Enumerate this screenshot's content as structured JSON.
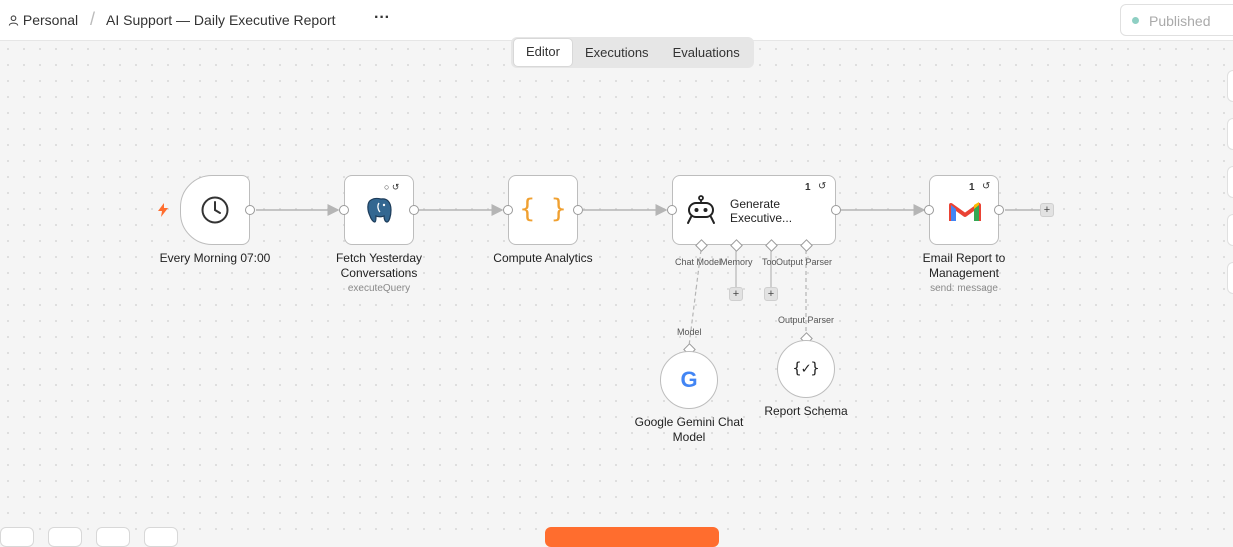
{
  "header": {
    "project": "Personal",
    "separator": "/",
    "workflow_name": "AI Support — Daily Executive Report",
    "more": "···",
    "status": "Published"
  },
  "tabs": [
    "Editor",
    "Executions",
    "Evaluations"
  ],
  "nodes": {
    "schedule": {
      "label": "Every Morning 07:00"
    },
    "postgres": {
      "label1": "Fetch Yesterday",
      "label2": "Conversations",
      "sub": "executeQuery"
    },
    "code": {
      "label": "Compute Analytics",
      "glyph": "{ }"
    },
    "agent": {
      "title1": "Generate",
      "title2": "Executive...",
      "badge": "1"
    },
    "gmail": {
      "label1": "Email Report to",
      "label2": "Management",
      "sub": "send: message",
      "badge": "1"
    },
    "gemini": {
      "label1": "Google Gemini Chat",
      "label2": "Model",
      "glyph": "G"
    },
    "schema": {
      "label": "Report Schema",
      "glyph": "{✓}"
    }
  },
  "connectors": {
    "chat_model": "Chat Model",
    "memory": "Memory",
    "tool": "Tool",
    "output_parser": "Output Parser",
    "model_label": "Model",
    "output_parser_label": "Output Parser"
  },
  "colors": {
    "accent": "#ff6d2e",
    "published_dot": "#8ecfc3",
    "gmail_red": "#ea4335",
    "code_orange": "#f0a030"
  }
}
